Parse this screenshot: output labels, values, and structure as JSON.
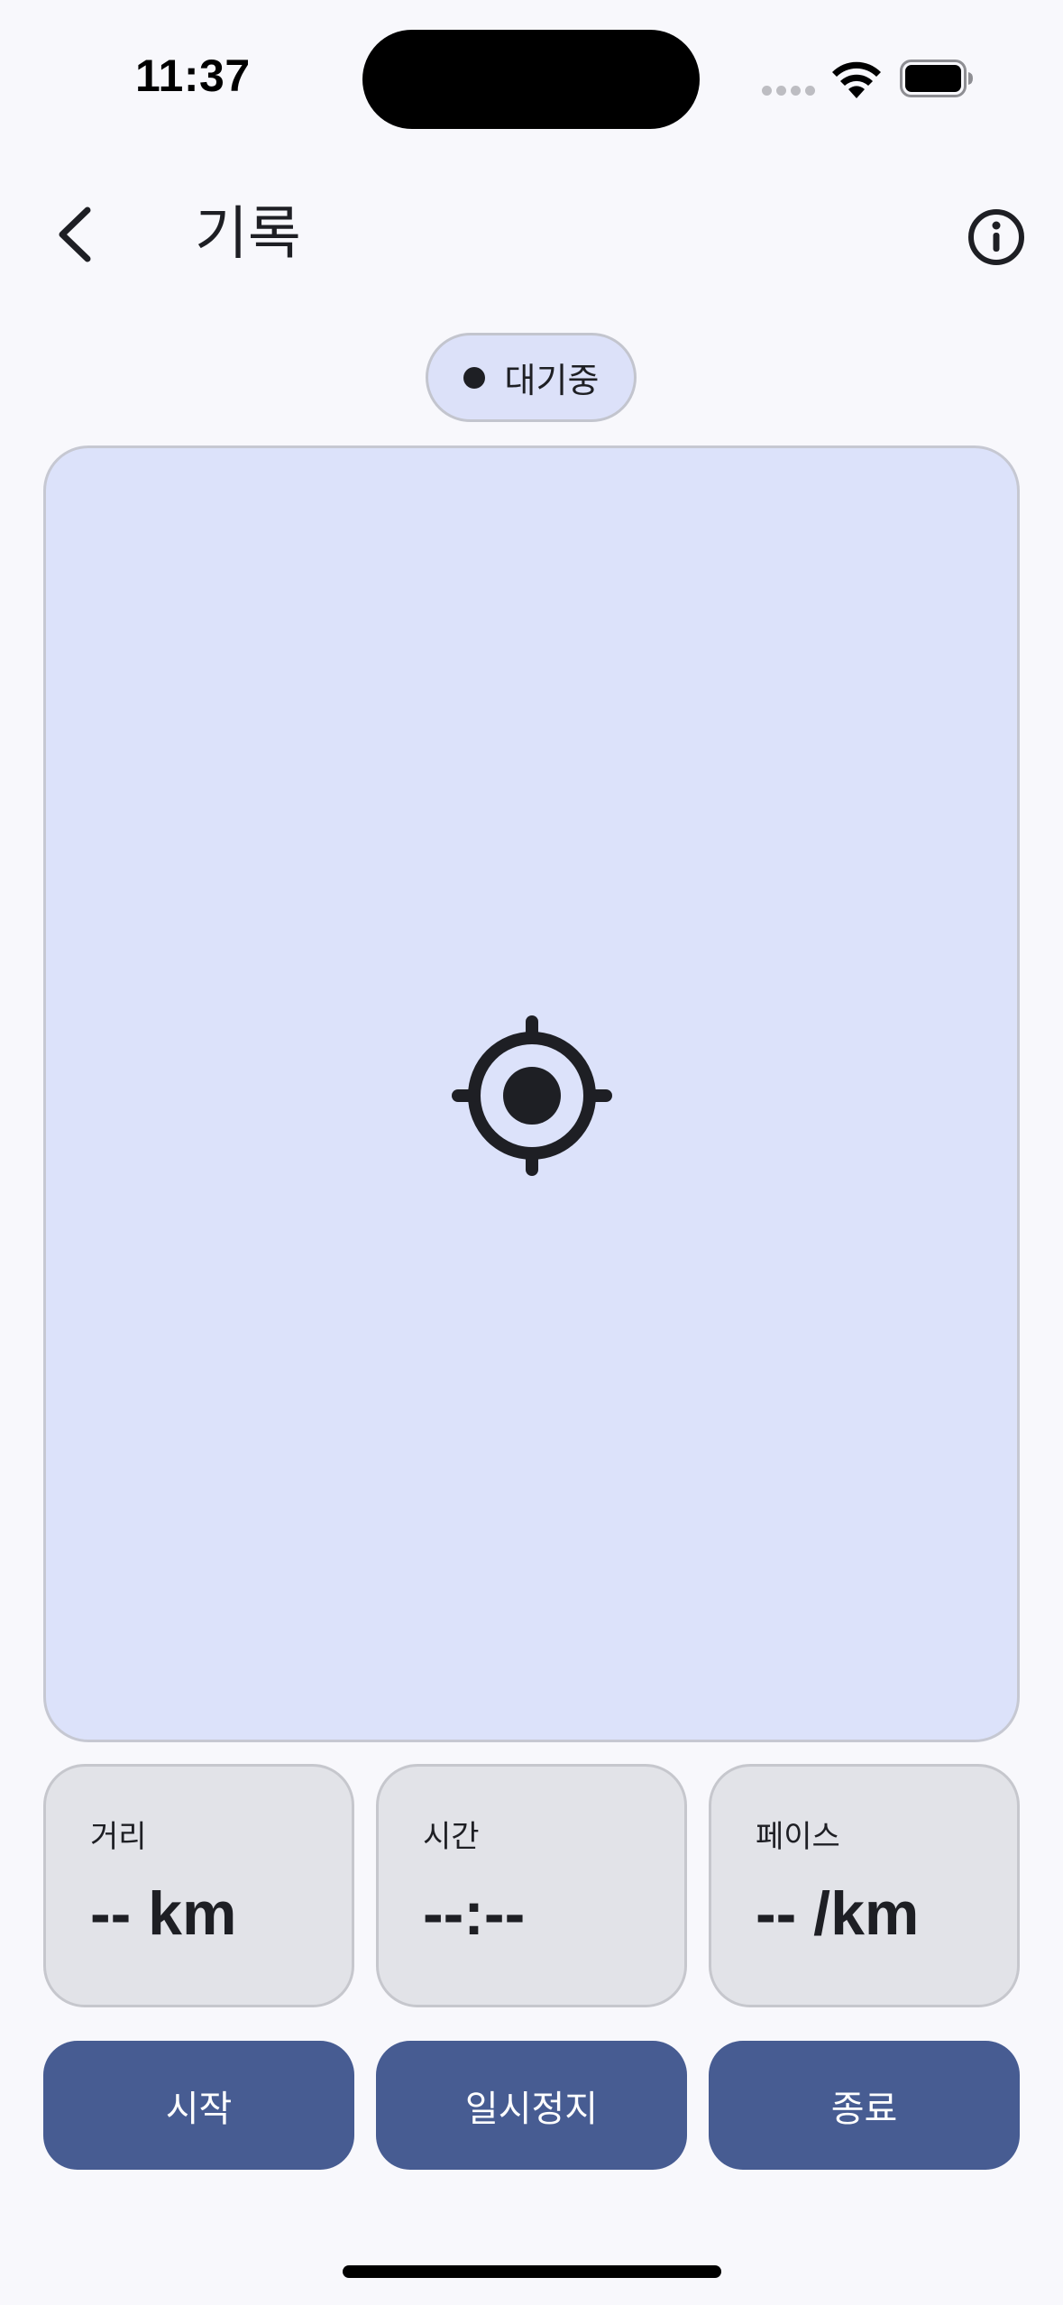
{
  "status_bar": {
    "time": "11:37"
  },
  "nav": {
    "title": "기록",
    "back_icon": "chevron-left-icon",
    "info_icon": "info-circle-icon"
  },
  "status_pill": {
    "text": "대기중"
  },
  "map": {
    "center_icon": "my-location-icon"
  },
  "stats": [
    {
      "label": "거리",
      "value": "-- km"
    },
    {
      "label": "시간",
      "value": "--:--"
    },
    {
      "label": "페이스",
      "value": "-- /km"
    }
  ],
  "actions": {
    "start_label": "시작",
    "pause_label": "일시정지",
    "stop_label": "종료"
  },
  "colors": {
    "background": "#F8F8FC",
    "map_fill": "#DCE2FA",
    "card_fill": "#E2E3E8",
    "button_fill": "#475C92",
    "text": "#1E1F24"
  }
}
